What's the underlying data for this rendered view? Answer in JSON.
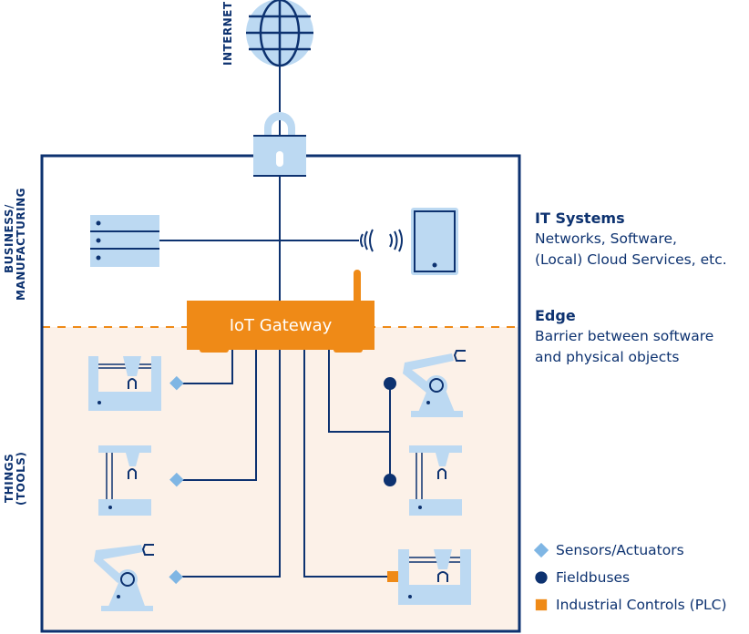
{
  "labels": {
    "internet": "INTERNET",
    "business_line1": "BUSINESS/",
    "business_line2": "MANUFACTURING",
    "things_line1": "THINGS",
    "things_line2": "(TOOLS)",
    "gateway": "IoT Gateway"
  },
  "info": {
    "it_systems": {
      "title": "IT Systems",
      "lines": [
        "Networks, Software,",
        "(Local) Cloud Services, etc."
      ]
    },
    "edge": {
      "title": "Edge",
      "lines": [
        "Barrier between software",
        "and physical objects"
      ]
    }
  },
  "legend": [
    {
      "shape": "diamond",
      "label": "Sensors/Actuators",
      "color": "#7fb6e4"
    },
    {
      "shape": "circle",
      "label": "Fieldbuses",
      "color": "#0d3270"
    },
    {
      "shape": "square",
      "label": "Industrial Controls (PLC)",
      "color": "#ef8a17"
    }
  ],
  "colors": {
    "navy": "#0d3270",
    "light_blue": "#bcd9f2",
    "sensor_blue": "#7fb6e4",
    "orange": "#ef8a17",
    "things_bg": "#fcf1e8"
  },
  "icons": [
    "globe-icon",
    "lock-icon",
    "server-icon",
    "tablet-icon",
    "wireless-icon",
    "gateway-antenna-icon",
    "gantry-machine-icon",
    "press-machine-icon",
    "robot-arm-icon"
  ]
}
